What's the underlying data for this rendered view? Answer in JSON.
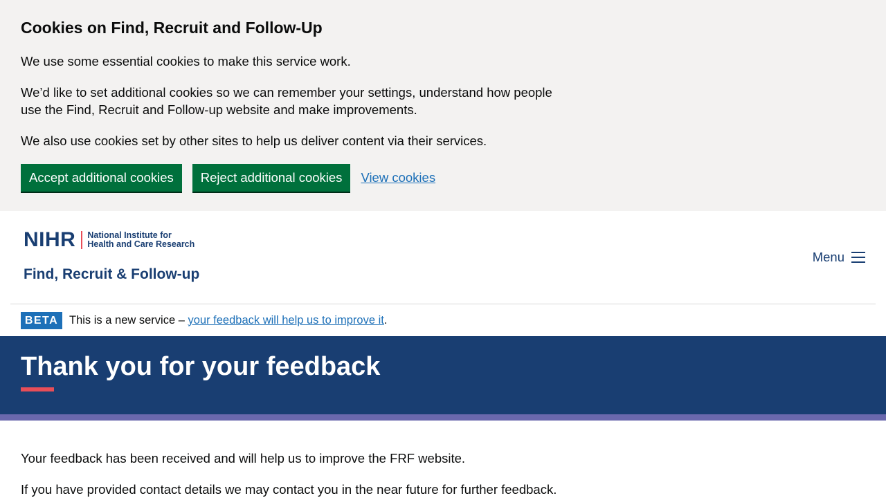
{
  "cookie_banner": {
    "title": "Cookies on Find, Recruit and Follow-Up",
    "paragraph_1": "We use some essential cookies to make this service work.",
    "paragraph_2": "We’d like to set additional cookies so we can remember your settings, understand how people use the Find, Recruit and Follow-up website and make improvements.",
    "paragraph_3": "We also use cookies set by other sites to help us deliver content via their services.",
    "accept_label": "Accept additional cookies",
    "reject_label": "Reject additional cookies",
    "view_label": "View cookies"
  },
  "header": {
    "logo_nihr": "NIHR",
    "logo_line_1": "National Institute for",
    "logo_line_2": "Health and Care Research",
    "service_name": "Find, Recruit & Follow-up",
    "menu_label": "Menu",
    "menu_icon": "hamburger-icon"
  },
  "beta_banner": {
    "tag": "BETA",
    "text_prefix": "This is a new service – ",
    "link_text": "your feedback will help us to improve it",
    "text_suffix": "."
  },
  "hero": {
    "title": "Thank you for your feedback"
  },
  "content": {
    "paragraph_1": "Your feedback has been received and will help us to improve the FRF website.",
    "paragraph_2": "If you have provided contact details we may contact you in the near future for further feedback."
  },
  "colors": {
    "brand_navy": "#193e72",
    "button_green": "#00703c",
    "link_blue": "#1d70b8",
    "accent_red": "#e84e58",
    "stripe_purple": "#6a68ad",
    "banner_grey": "#f3f2f1"
  }
}
